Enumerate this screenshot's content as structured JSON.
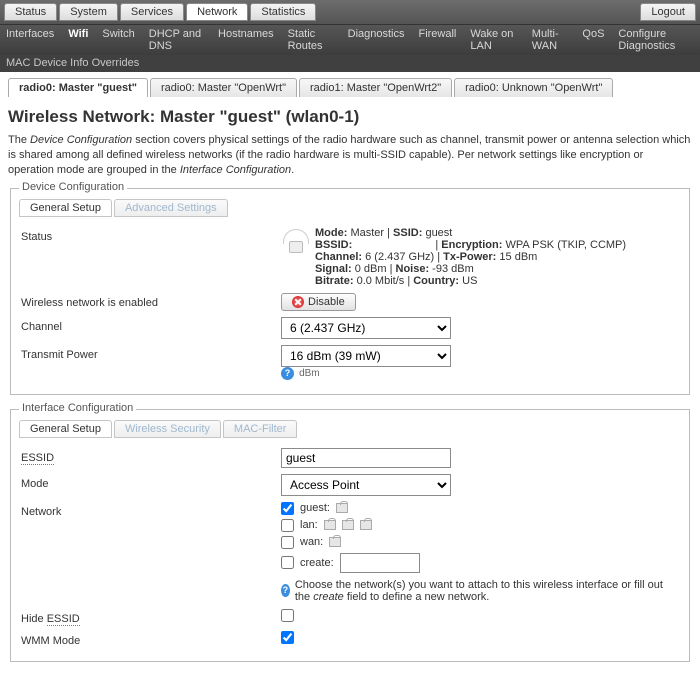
{
  "topTabs": [
    "Status",
    "System",
    "Services",
    "Network",
    "Statistics"
  ],
  "topTabsActive": 3,
  "logout": "Logout",
  "subTabs": [
    "Interfaces",
    "Wifi",
    "Switch",
    "DHCP and DNS",
    "Hostnames",
    "Static Routes",
    "Diagnostics",
    "Firewall",
    "Wake on LAN",
    "Multi-WAN",
    "QoS",
    "Configure Diagnostics"
  ],
  "subTabsActive": 1,
  "sub2": "MAC Device Info Overrides",
  "pageTabs": [
    "radio0: Master \"guest\"",
    "radio0: Master \"OpenWrt\"",
    "radio1: Master \"OpenWrt2\"",
    "radio0: Unknown \"OpenWrt\""
  ],
  "pageTabsActive": 0,
  "h2": "Wireless Network: Master \"guest\" (wlan0-1)",
  "desc_pre": "The ",
  "desc_em1": "Device Configuration",
  "desc_mid": " section covers physical settings of the radio hardware such as channel, transmit power or antenna selection which is shared among all defined wireless networks (if the radio hardware is multi-SSID capable). Per network settings like encryption or operation mode are grouped in the ",
  "desc_em2": "Interface Configuration",
  "desc_post": ".",
  "devcfg": {
    "legend": "Device Configuration",
    "tabs": [
      "General Setup",
      "Advanced Settings"
    ],
    "status_label": "Status",
    "mode_l": "Mode:",
    "mode_v": " Master | ",
    "ssid_l": "SSID:",
    "ssid_v": " guest",
    "bssid_l": "BSSID: ",
    "enc_l": "Encryption:",
    "enc_v": " WPA PSK (TKIP, CCMP)",
    "chan_l": "Channel:",
    "chan_v": " 6 (2.437 GHz) | ",
    "tx_l": "Tx-Power:",
    "tx_v": " 15 dBm",
    "sig_l": "Signal:",
    "sig_v": " 0 dBm | ",
    "noise_l": "Noise:",
    "noise_v": " -93 dBm",
    "br_l": "Bitrate:",
    "br_v": " 0.0 Mbit/s | ",
    "cn_l": "Country:",
    "cn_v": " US",
    "enabled": "Wireless network is enabled",
    "disable": "Disable",
    "channel_label": "Channel",
    "channel_value": "6 (2.437 GHz)",
    "txpower_label": "Transmit Power",
    "txpower_value": "16 dBm (39 mW)",
    "txpower_unit": "dBm"
  },
  "ifcfg": {
    "legend": "Interface Configuration",
    "tabs": [
      "General Setup",
      "Wireless Security",
      "MAC-Filter"
    ],
    "essid_label": "ESSID",
    "essid_value": "guest",
    "mode_label": "Mode",
    "mode_value": "Access Point",
    "network_label": "Network",
    "networks": [
      {
        "name": "guest:",
        "checked": true
      },
      {
        "name": "lan:",
        "checked": false
      },
      {
        "name": "wan:",
        "checked": false
      }
    ],
    "create_label": "create:",
    "netnote_pre": "Choose the network(s) you want to attach to this wireless interface or fill out the ",
    "netnote_em": "create",
    "netnote_post": " field to define a new network.",
    "hide_label": "Hide ",
    "hide_label2": "ESSID",
    "wmm_label": "WMM Mode"
  }
}
